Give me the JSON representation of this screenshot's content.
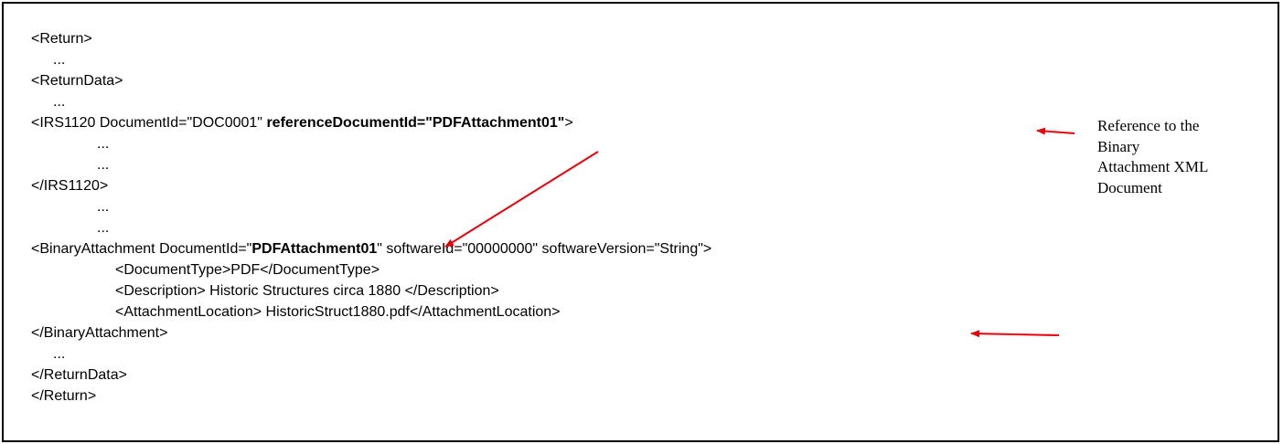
{
  "lines": {
    "l1": "<Return>",
    "l2": "...",
    "l3": "<ReturnData>",
    "l4": "...",
    "l5_a": "<IRS1120 DocumentId=\"DOC0001\" ",
    "l5_b": "referenceDocumentId=\"PDFAttachment01\"",
    "l5_c": ">",
    "l6": "...",
    "l7": "...",
    "l8": "</IRS1120>",
    "l9": "...",
    "l10": "...",
    "l11_a": "<BinaryAttachment DocumentId=\"",
    "l11_b": "PDFAttachment01",
    "l11_c": "\" softwareId=\"00000000\" softwareVersion=\"String\">",
    "l12": "<DocumentType>PDF</DocumentType>",
    "l13": "<Description> Historic Structures circa 1880 </Description>",
    "l14": "<AttachmentLocation> HistoricStruct1880.pdf</AttachmentLocation>",
    "l15": "</BinaryAttachment>",
    "l16": "...",
    "l17": "</ReturnData>",
    "l18": "</Return>"
  },
  "annotation": {
    "line1": "Reference to the",
    "line2": "Binary",
    "line3": "Attachment XML",
    "line4": "Document"
  },
  "colors": {
    "arrow": "#e8000b",
    "border": "#000000",
    "text": "#000000"
  }
}
